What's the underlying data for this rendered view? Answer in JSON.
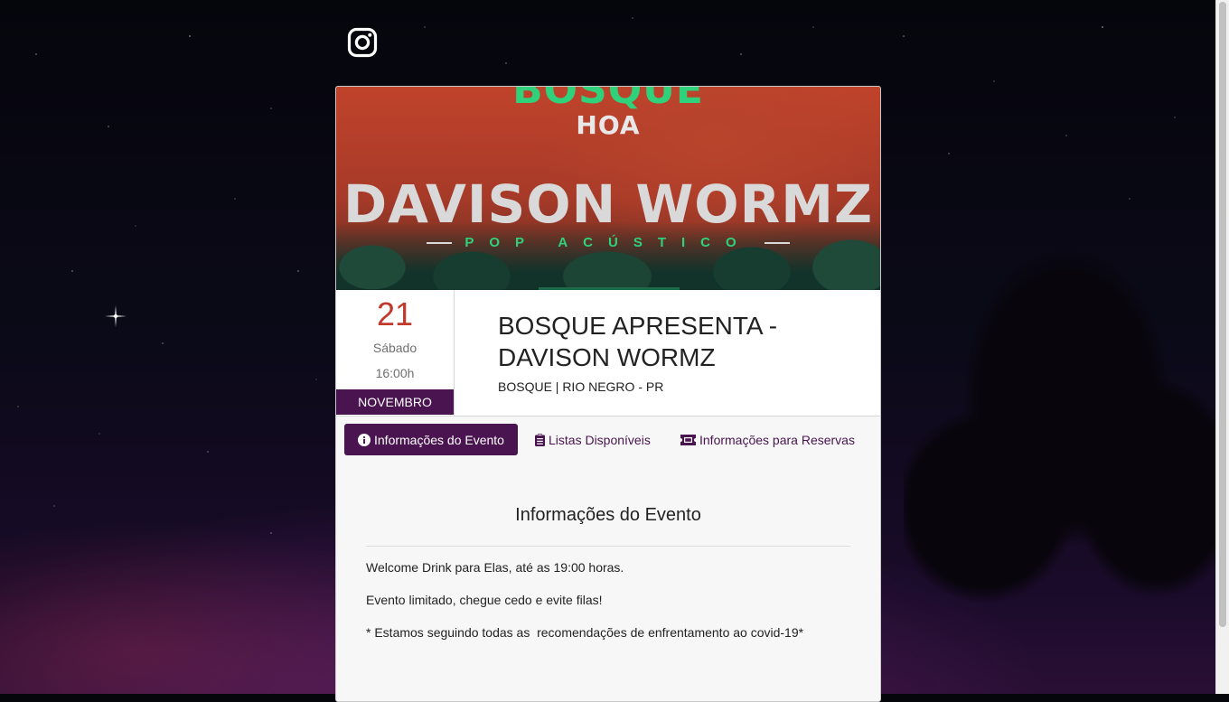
{
  "social": {
    "instagram_icon": "instagram-icon"
  },
  "banner": {
    "brand_top": "BOSQUE",
    "brand_bottom": "HOA",
    "artist": "DAVISON WORMZ",
    "genre": "POP ACÚSTICO"
  },
  "event": {
    "day": "21",
    "weekday": "Sábado",
    "time": "16:00h",
    "month": "NOVEMBRO",
    "title": "BOSQUE APRESENTA - DAVISON WORMZ",
    "venue": "BOSQUE | RIO NEGRO - PR"
  },
  "tabs": [
    {
      "label": "Informações do Evento",
      "icon": "info-circle-icon",
      "active": true
    },
    {
      "label": "Listas Disponíveis",
      "icon": "clipboard-icon",
      "active": false
    },
    {
      "label": "Informações para Reservas",
      "icon": "ticket-icon",
      "active": false
    }
  ],
  "section": {
    "heading": "Informações do Evento",
    "paragraphs": [
      "Welcome Drink para Elas, até as 19:00 horas.",
      "Evento limitado, chegue cedo e evite filas!",
      "* Estamos seguindo todas as  recomendações de enfrentamento ao covid-19*"
    ]
  },
  "colors": {
    "accent": "#4a1450",
    "day_red": "#c0392b",
    "brand_green": "#2fd27a"
  }
}
